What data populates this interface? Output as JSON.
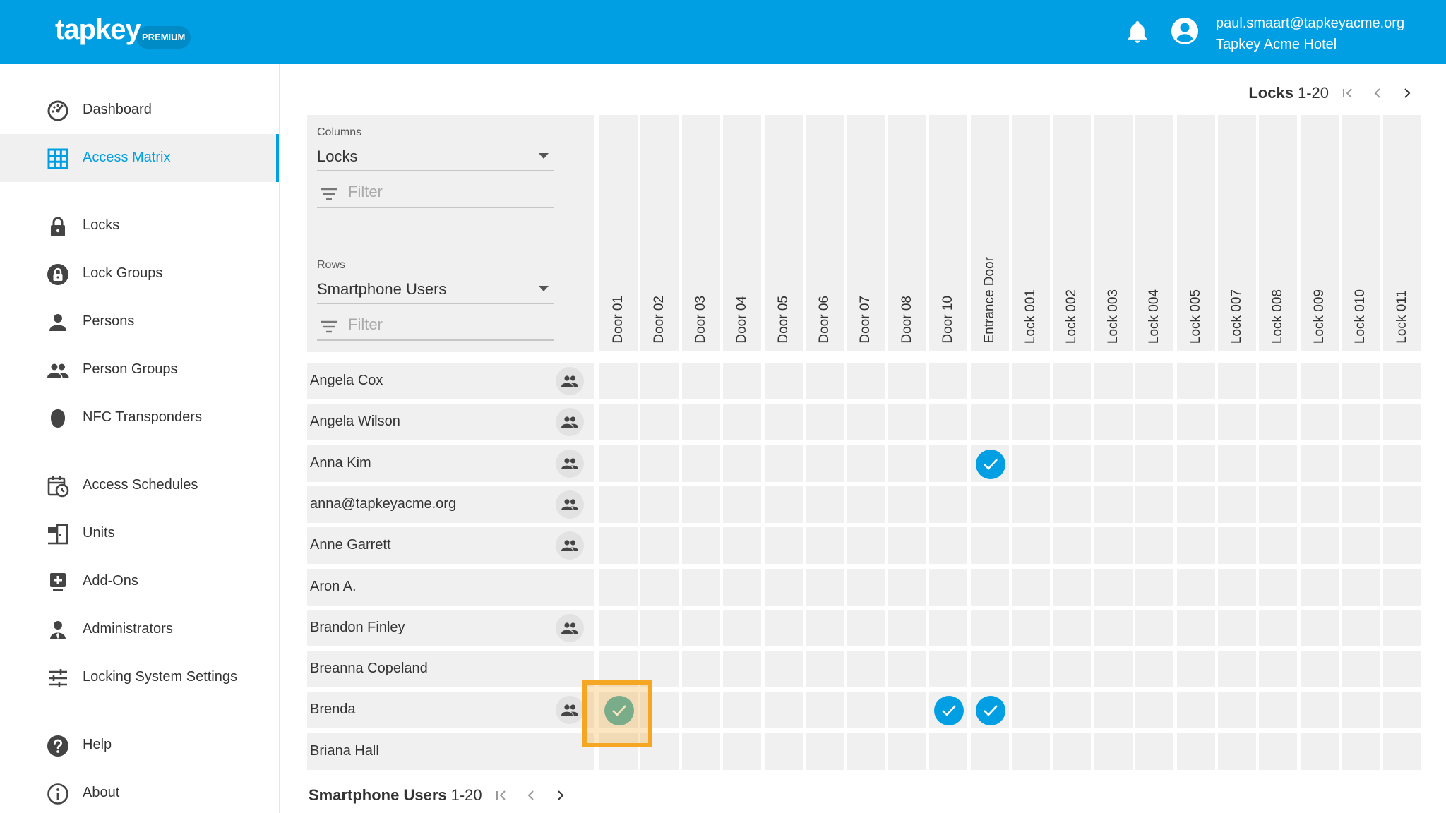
{
  "header": {
    "brand": "tapkey",
    "badge": "PREMIUM",
    "user_email": "paul.smaart@tapkeyacme.org",
    "organization": "Tapkey Acme Hotel",
    "notification_icon": "bell-icon",
    "account_icon": "account-circle-icon"
  },
  "sidebar": {
    "items": [
      {
        "label": "Dashboard",
        "icon": "speedometer-icon",
        "active": false
      },
      {
        "label": "Access Matrix",
        "icon": "grid-icon",
        "active": true
      },
      {
        "label": "Locks",
        "icon": "lock-icon",
        "active": false
      },
      {
        "label": "Lock Groups",
        "icon": "lock-group-icon",
        "active": false
      },
      {
        "label": "Persons",
        "icon": "person-icon",
        "active": false
      },
      {
        "label": "Person Groups",
        "icon": "people-icon",
        "active": false
      },
      {
        "label": "NFC Transponders",
        "icon": "transponder-icon",
        "active": false
      },
      {
        "label": "Access Schedules",
        "icon": "calendar-clock-icon",
        "active": false
      },
      {
        "label": "Units",
        "icon": "door-unit-icon",
        "active": false
      },
      {
        "label": "Add-Ons",
        "icon": "add-box-icon",
        "active": false
      },
      {
        "label": "Administrators",
        "icon": "admin-icon",
        "active": false
      },
      {
        "label": "Locking System Settings",
        "icon": "sliders-icon",
        "active": false
      },
      {
        "label": "Help",
        "icon": "help-icon",
        "active": false
      },
      {
        "label": "About",
        "icon": "info-icon",
        "active": false
      }
    ]
  },
  "pager_top": {
    "label": "Locks",
    "range": "1-20"
  },
  "pager_bottom": {
    "label": "Smartphone Users",
    "range": "1-20"
  },
  "controls": {
    "columns_label": "Columns",
    "columns_value": "Locks",
    "rows_label": "Rows",
    "rows_value": "Smartphone Users",
    "filter_placeholder": "Filter"
  },
  "columns": [
    "Door 01",
    "Door 02",
    "Door 03",
    "Door 04",
    "Door 05",
    "Door 06",
    "Door 07",
    "Door 08",
    "Door 10",
    "Entrance Door",
    "Lock 001",
    "Lock 002",
    "Lock 003",
    "Lock 004",
    "Lock 005",
    "Lock 007",
    "Lock 008",
    "Lock 009",
    "Lock 010",
    "Lock 011"
  ],
  "rows": [
    {
      "name": "Angela Cox",
      "has_groups": true
    },
    {
      "name": "Angela Wilson",
      "has_groups": true
    },
    {
      "name": "Anna Kim",
      "has_groups": true
    },
    {
      "name": "anna@tapkeyacme.org",
      "has_groups": true
    },
    {
      "name": "Anne Garrett",
      "has_groups": true
    },
    {
      "name": "Aron A.",
      "has_groups": false
    },
    {
      "name": "Brandon Finley",
      "has_groups": true
    },
    {
      "name": "Breanna Copeland",
      "has_groups": false
    },
    {
      "name": "Brenda",
      "has_groups": true
    },
    {
      "name": "Briana Hall",
      "has_groups": false
    }
  ],
  "grants": [
    {
      "row": 2,
      "col": 9,
      "style": "granted"
    },
    {
      "row": 8,
      "col": 0,
      "style": "selected"
    },
    {
      "row": 8,
      "col": 8,
      "style": "granted"
    },
    {
      "row": 8,
      "col": 9,
      "style": "granted"
    }
  ],
  "colors": {
    "brand": "#009fe3",
    "granted": "#009fe3",
    "selected": "#4ab0b0",
    "highlight": "#f5a623"
  }
}
